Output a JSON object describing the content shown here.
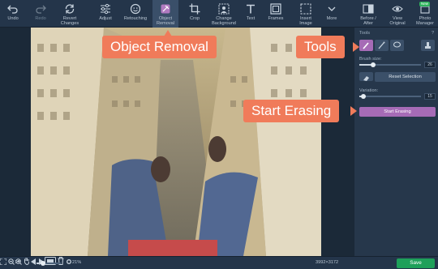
{
  "toolbar": {
    "items": [
      {
        "label": "Undo",
        "icon": "undo-icon",
        "state": "normal"
      },
      {
        "label": "Redo",
        "icon": "redo-icon",
        "state": "disabled"
      },
      {
        "label": "Revert\nChanges",
        "icon": "revert-icon",
        "state": "normal"
      },
      {
        "label": "Adjust",
        "icon": "sliders-icon",
        "state": "normal"
      },
      {
        "label": "Retouching",
        "icon": "retouch-icon",
        "state": "normal"
      },
      {
        "label": "Object\nRemoval",
        "icon": "object-removal-icon",
        "state": "active"
      },
      {
        "label": "Crop",
        "icon": "crop-icon",
        "state": "normal"
      },
      {
        "label": "Change\nBackground",
        "icon": "change-background-icon",
        "state": "normal"
      },
      {
        "label": "Text",
        "icon": "text-icon",
        "state": "normal"
      },
      {
        "label": "Frames",
        "icon": "frames-icon",
        "state": "normal"
      },
      {
        "label": "Insert\nImage",
        "icon": "insert-image-icon",
        "state": "normal"
      },
      {
        "label": "More",
        "icon": "chevron-down-icon",
        "state": "normal"
      },
      {
        "label": "Before /\nAfter",
        "icon": "before-after-icon",
        "state": "normal"
      },
      {
        "label": "View\nOriginal",
        "icon": "eye-icon",
        "state": "normal"
      },
      {
        "label": "Photo\nManager",
        "icon": "photo-manager-icon",
        "state": "normal",
        "badge": "New"
      }
    ]
  },
  "panel": {
    "tools_label": "Tools",
    "help": "?",
    "brush_size_label": "Brush size:",
    "brush_size_value": "26",
    "brush_size_fraction": 0.22,
    "reset_selection": "Reset Selection",
    "variation_label": "Variation:",
    "variation_value": "15",
    "variation_fraction": 0.06,
    "start_erasing": "Start Erasing"
  },
  "callouts": {
    "object_removal": "Object Removal",
    "tools": "Tools",
    "start_erasing": "Start Erasing"
  },
  "bottombar": {
    "fit": "1:1",
    "zoom": "21%",
    "dimensions": "3992×3172",
    "save": "Save",
    "zoom_fraction": 0.28
  },
  "colors": {
    "accent": "#a66bb6",
    "callout": "#f07b5a",
    "save": "#1ea05a",
    "badge": "#2fb35d"
  }
}
